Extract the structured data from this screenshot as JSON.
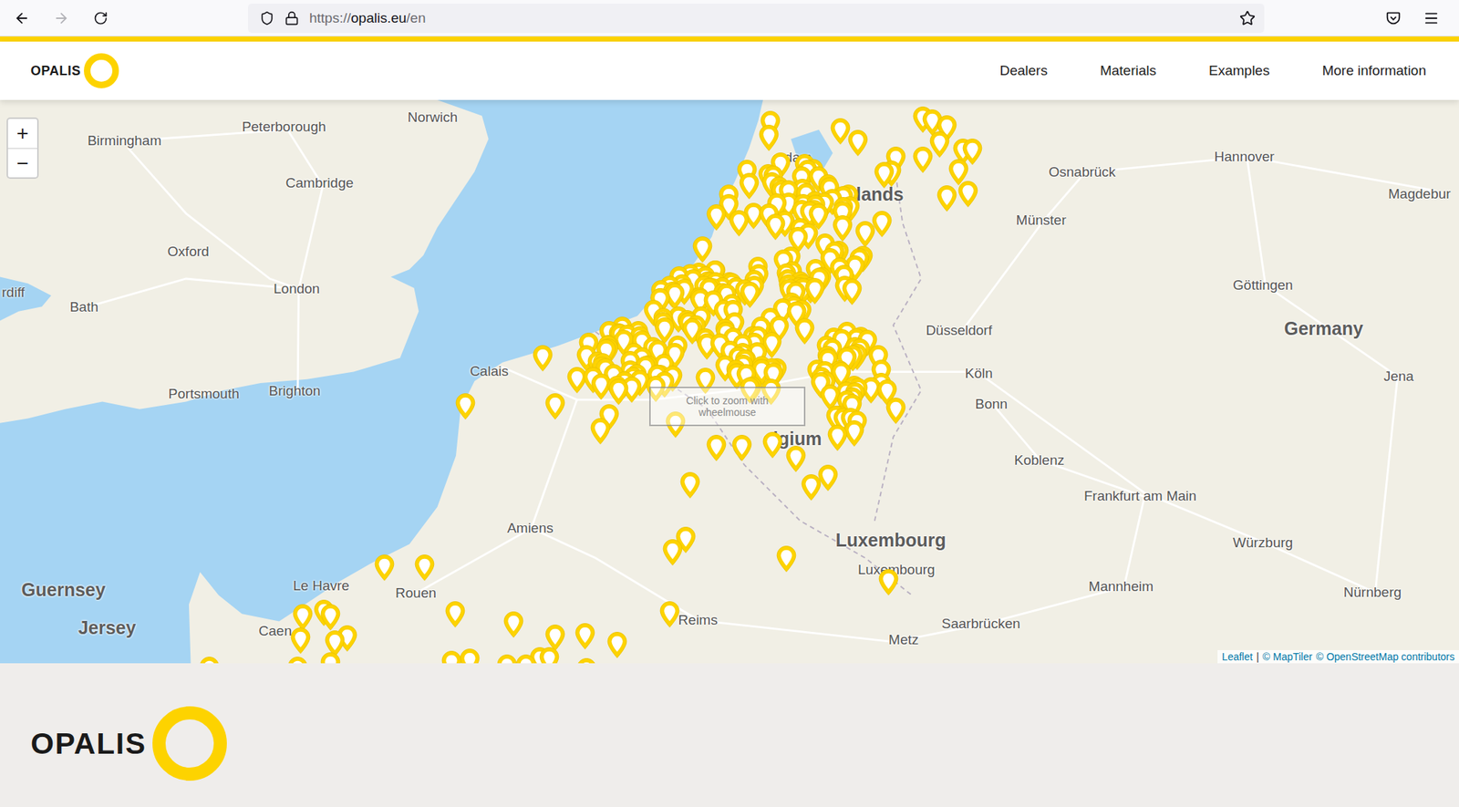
{
  "browser": {
    "url": {
      "scheme": "https://",
      "host": "opalis.eu",
      "path": "/en"
    },
    "back_enabled": true,
    "forward_enabled": false,
    "bookmarked": false
  },
  "header": {
    "logo": "OPALIS",
    "nav": [
      {
        "label": "Dealers"
      },
      {
        "label": "Materials"
      },
      {
        "label": "Examples"
      },
      {
        "label": "More information"
      }
    ]
  },
  "map": {
    "zoom_buttons": [
      "+",
      "−"
    ],
    "hint": "Click to zoom with wheelmouse",
    "labels": [
      {
        "text": "Birmingham",
        "kind": "city"
      },
      {
        "text": "Peterborough",
        "kind": "city"
      },
      {
        "text": "Norwich",
        "kind": "city"
      },
      {
        "text": "Cambridge",
        "kind": "city"
      },
      {
        "text": "Oxford",
        "kind": "city"
      },
      {
        "text": "London",
        "kind": "city"
      },
      {
        "text": "Bath",
        "kind": "city"
      },
      {
        "text": "rdiff",
        "kind": "city"
      },
      {
        "text": "Portsmouth",
        "kind": "city"
      },
      {
        "text": "Brighton",
        "kind": "city"
      },
      {
        "text": "Calais",
        "kind": "city"
      },
      {
        "text": "Amiens",
        "kind": "city"
      },
      {
        "text": "Le Havre",
        "kind": "city"
      },
      {
        "text": "Rouen",
        "kind": "city"
      },
      {
        "text": "Caen",
        "kind": "city"
      },
      {
        "text": "Reims",
        "kind": "city"
      },
      {
        "text": "Metz",
        "kind": "city"
      },
      {
        "text": "Guernsey",
        "kind": "country"
      },
      {
        "text": "Jersey",
        "kind": "country"
      },
      {
        "text": "Luxembourg",
        "kind": "country"
      },
      {
        "text": "Luxembourg",
        "kind": "city"
      },
      {
        "text": "Saarbrücken",
        "kind": "city"
      },
      {
        "text": "Mannheim",
        "kind": "city"
      },
      {
        "text": "Nürnberg",
        "kind": "city"
      },
      {
        "text": "Würzburg",
        "kind": "city"
      },
      {
        "text": "Frankfurt am Main",
        "kind": "city"
      },
      {
        "text": "Koblenz",
        "kind": "city"
      },
      {
        "text": "Bonn",
        "kind": "city"
      },
      {
        "text": "Köln",
        "kind": "city"
      },
      {
        "text": "Düsseldorf",
        "kind": "city"
      },
      {
        "text": "Münster",
        "kind": "city"
      },
      {
        "text": "Osnabrück",
        "kind": "city"
      },
      {
        "text": "Hannover",
        "kind": "city"
      },
      {
        "text": "Magdebur",
        "kind": "city"
      },
      {
        "text": "Göttingen",
        "kind": "city"
      },
      {
        "text": "Germany",
        "kind": "country"
      },
      {
        "text": "Jena",
        "kind": "city"
      },
      {
        "text": "erdam",
        "kind": "city"
      },
      {
        "text": "lands",
        "kind": "country"
      },
      {
        "text": "elgium",
        "kind": "country"
      }
    ],
    "attribution": {
      "links": [
        "Leaflet",
        "© MapTiler",
        "© OpenStreetMap contributors"
      ],
      "separator": "|"
    }
  },
  "footer": {
    "logo": "OPALIS"
  }
}
